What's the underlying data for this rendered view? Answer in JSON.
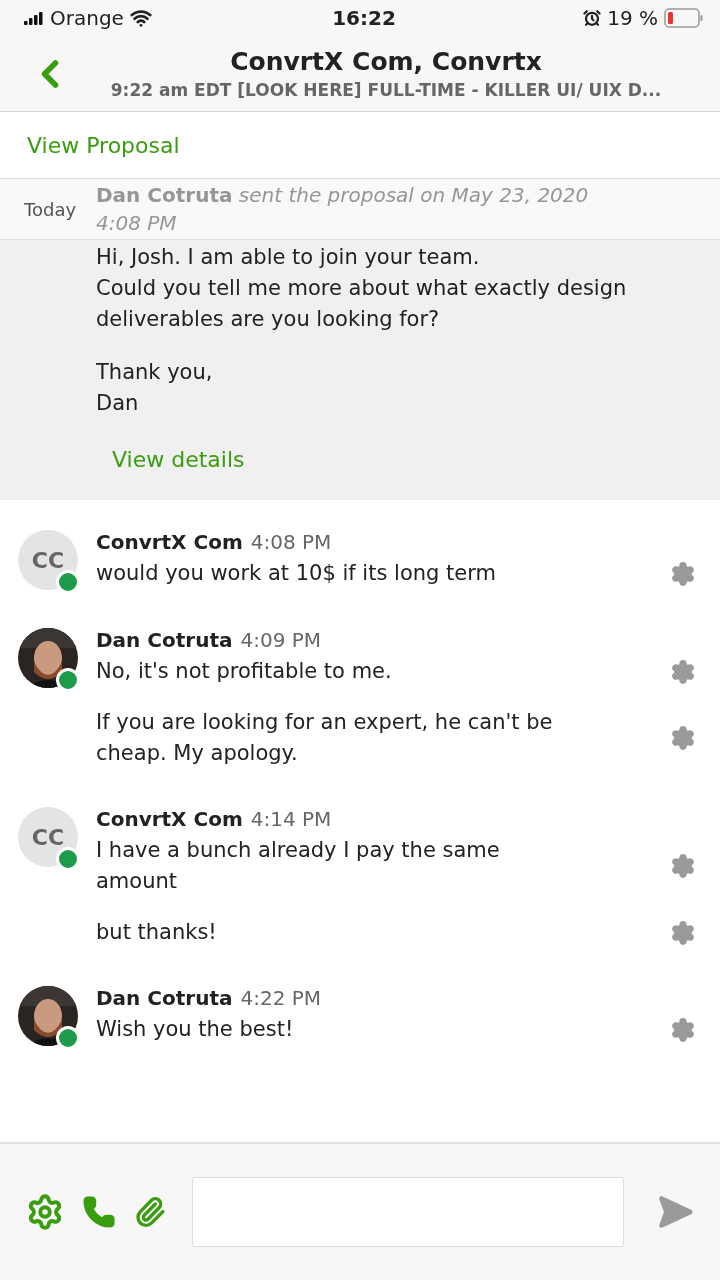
{
  "status_bar": {
    "carrier": "Orange",
    "time": "16:22",
    "battery": "19 %"
  },
  "header": {
    "title": "ConvrtX Com, Convrtx",
    "subtitle": "9:22 am EDT [LOOK HERE] FULL-TIME - KILLER UI/ UIX D..."
  },
  "view_proposal": "View Proposal",
  "proposal": {
    "sender": "Dan Cotruta",
    "action": "sent the proposal on May 23, 2020 4:08 PM",
    "date_divider": "Today",
    "paragraphs": [
      [
        "Hi, Josh. I am able to join your team.",
        "Could you tell me more about what exactly design deliverables are you looking for?"
      ],
      [
        "Thank you,",
        "Dan"
      ]
    ],
    "link": "View details"
  },
  "messages": [
    {
      "avatar": {
        "kind": "initials",
        "text": "CC"
      },
      "online": true,
      "name": "ConvrtX Com",
      "time": "4:08 PM",
      "texts": [
        "would you work at 10$ if its long term"
      ]
    },
    {
      "avatar": {
        "kind": "picture"
      },
      "online": true,
      "name": "Dan Cotruta",
      "time": "4:09 PM",
      "texts": [
        "No, it's not profitable to me.",
        "If you are looking for an expert, he can't be cheap. My apology."
      ]
    },
    {
      "avatar": {
        "kind": "initials",
        "text": "CC"
      },
      "online": true,
      "name": "ConvrtX Com",
      "time": "4:14 PM",
      "texts": [
        "I have a bunch already I pay the same amount",
        "but thanks!"
      ]
    },
    {
      "avatar": {
        "kind": "picture"
      },
      "online": true,
      "name": "Dan Cotruta",
      "time": "4:22 PM",
      "texts": [
        "Wish you the best!"
      ]
    }
  ]
}
